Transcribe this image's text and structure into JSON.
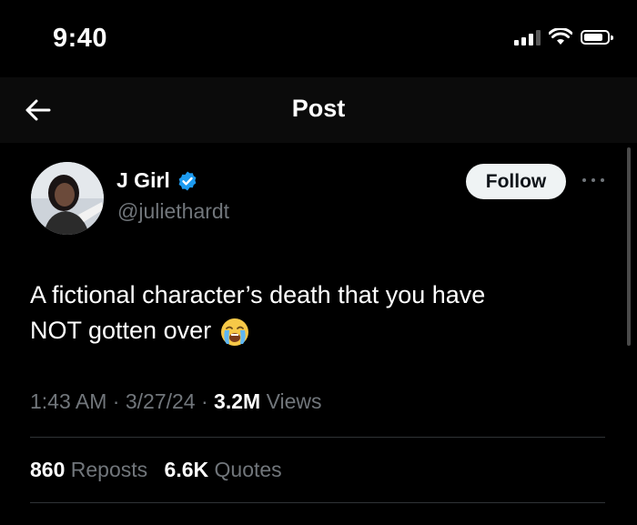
{
  "status_bar": {
    "time": "9:40"
  },
  "nav": {
    "title": "Post"
  },
  "author": {
    "display_name": "J Girl",
    "handle": "@juliethardt",
    "verified": true
  },
  "follow_label": "Follow",
  "tweet": {
    "line1": "A fictional character’s death that you have",
    "line2": "NOT gotten over",
    "emoji": "loudly-crying-face"
  },
  "meta": {
    "time": "1:43 AM",
    "sep1": "·",
    "date": "3/27/24",
    "sep2": "·",
    "views_count": "3.2M",
    "views_label": "Views"
  },
  "stats": {
    "reposts_count": "860",
    "reposts_label": "Reposts",
    "quotes_count": "6.6K",
    "quotes_label": "Quotes"
  },
  "colors": {
    "background": "#000000",
    "text_primary": "#ffffff",
    "text_secondary": "#71767b",
    "verified_blue": "#1d9bf0",
    "follow_bg": "#eff3f4",
    "divider": "#2f3336"
  }
}
